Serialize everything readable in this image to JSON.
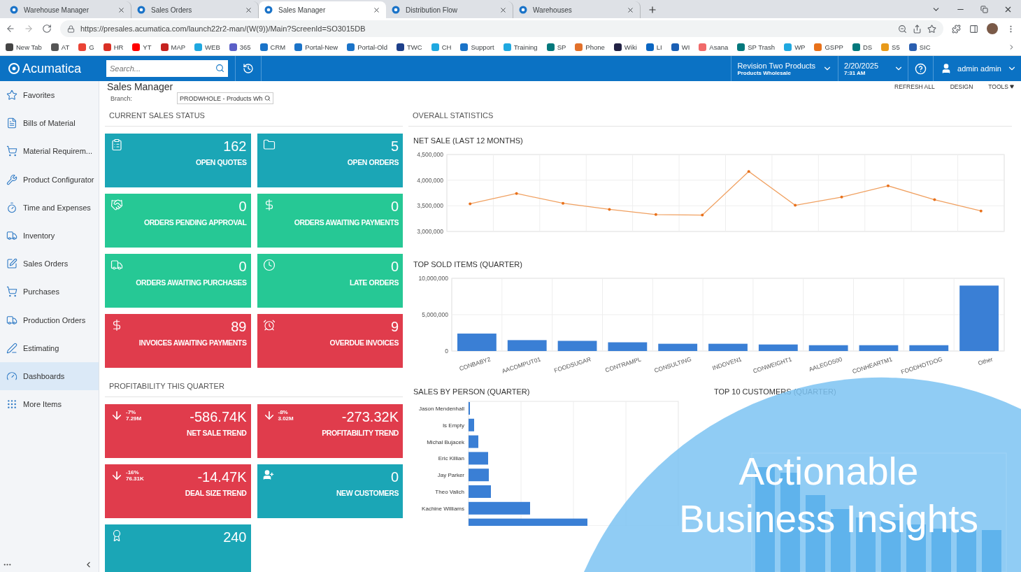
{
  "browser": {
    "tabs": [
      {
        "title": "Warehouse Manager",
        "selected": false
      },
      {
        "title": "Sales Orders",
        "selected": false
      },
      {
        "title": "Sales Manager",
        "selected": true
      },
      {
        "title": "Distribution Flow",
        "selected": false
      },
      {
        "title": "Warehouses",
        "selected": false
      }
    ],
    "url": "https://presales.acumatica.com/launch22r2-man/(W(9))/Main?ScreenId=SO3015DB",
    "bookmarks": [
      {
        "label": "New Tab",
        "color": "#444444"
      },
      {
        "label": "AT",
        "color": "#555555"
      },
      {
        "label": "G",
        "color": "#ea4335"
      },
      {
        "label": "HR",
        "color": "#d93025"
      },
      {
        "label": "YT",
        "color": "#ff0000"
      },
      {
        "label": "MAP",
        "color": "#c5221f"
      },
      {
        "label": "WEB",
        "color": "#1fa8e0"
      },
      {
        "label": "365",
        "color": "#5b5fc7"
      },
      {
        "label": "CRM",
        "color": "#1a73c8"
      },
      {
        "label": "Portal-New",
        "color": "#1a73c8"
      },
      {
        "label": "Portal-Old",
        "color": "#1a73c8"
      },
      {
        "label": "TWC",
        "color": "#1d3f8a"
      },
      {
        "label": "CH",
        "color": "#1fa8e0"
      },
      {
        "label": "Support",
        "color": "#1a73c8"
      },
      {
        "label": "Training",
        "color": "#1fa8e0"
      },
      {
        "label": "SP",
        "color": "#03787c"
      },
      {
        "label": "Phone",
        "color": "#e2712b"
      },
      {
        "label": "Wiki",
        "color": "#222244"
      },
      {
        "label": "LI",
        "color": "#0a66c2"
      },
      {
        "label": "WI",
        "color": "#1a5fb4"
      },
      {
        "label": "Asana",
        "color": "#f06a6a"
      },
      {
        "label": "SP Trash",
        "color": "#03787c"
      },
      {
        "label": "WP",
        "color": "#1fa8e0"
      },
      {
        "label": "GSPP",
        "color": "#e8711a"
      },
      {
        "label": "DS",
        "color": "#03787c"
      },
      {
        "label": "S5",
        "color": "#e89a1a"
      },
      {
        "label": "SIC",
        "color": "#2a5fb0"
      }
    ]
  },
  "app": {
    "logo": "Acumatica",
    "search": {
      "placeholder": "Search..."
    },
    "company": {
      "name": "Revision Two Products",
      "branch": "Products Wholesale"
    },
    "date": "2/20/2025",
    "time": "7:31 AM",
    "user": "admin admin"
  },
  "sidebar": {
    "items": [
      {
        "label": "Favorites",
        "selected": false
      },
      {
        "label": "Bills of Material",
        "selected": false
      },
      {
        "label": "Material Requirem...",
        "selected": false
      },
      {
        "label": "Product Configurator",
        "selected": false
      },
      {
        "label": "Time and Expenses",
        "selected": false
      },
      {
        "label": "Inventory",
        "selected": false
      },
      {
        "label": "Sales Orders",
        "selected": false
      },
      {
        "label": "Purchases",
        "selected": false
      },
      {
        "label": "Production Orders",
        "selected": false
      },
      {
        "label": "Estimating",
        "selected": false
      },
      {
        "label": "Dashboards",
        "selected": true
      },
      {
        "label": "More Items",
        "selected": false
      }
    ]
  },
  "page": {
    "title": "Sales Manager",
    "actions": [
      "REFRESH ALL",
      "DESIGN",
      "TOOLS"
    ],
    "branch": {
      "label": "Branch:",
      "value": "PRODWHOLE - Products Wh"
    }
  },
  "current_sales_status": {
    "title": "CURRENT SALES STATUS",
    "tiles": [
      {
        "value": "162",
        "label": "OPEN QUOTES",
        "color": "#1ba6b6"
      },
      {
        "value": "5",
        "label": "OPEN ORDERS",
        "color": "#1ba6b6"
      },
      {
        "value": "0",
        "label": "ORDERS PENDING APPROVAL",
        "color": "#26c895"
      },
      {
        "value": "0",
        "label": "ORDERS AWAITING PAYMENTS",
        "color": "#26c895"
      },
      {
        "value": "0",
        "label": "ORDERS AWAITING PURCHASES",
        "color": "#26c895"
      },
      {
        "value": "0",
        "label": "LATE ORDERS",
        "color": "#26c895"
      },
      {
        "value": "89",
        "label": "INVOICES AWAITING PAYMENTS",
        "color": "#e03c4c"
      },
      {
        "value": "9",
        "label": "OVERDUE INVOICES",
        "color": "#e03c4c"
      }
    ]
  },
  "profitability": {
    "title": "PROFITABILITY THIS QUARTER",
    "tiles": [
      {
        "kind": "trend",
        "change": "-7%",
        "previous": "7.29M",
        "value": "-586.74K",
        "label": "NET SALE TREND",
        "color": "#e03c4c"
      },
      {
        "kind": "trend",
        "change": "-8%",
        "previous": "3.02M",
        "value": "-273.32K",
        "label": "PROFITABILITY TREND",
        "color": "#e03c4c"
      },
      {
        "kind": "trend",
        "change": "-16%",
        "previous": "76.31K",
        "value": "-14.47K",
        "label": "DEAL SIZE TREND",
        "color": "#e03c4c"
      },
      {
        "kind": "count",
        "value": "0",
        "label": "NEW CUSTOMERS",
        "color": "#1ba6b6"
      },
      {
        "kind": "count",
        "value": "240",
        "color": "#1ba6b6"
      }
    ]
  },
  "overall_statistics": {
    "title": "OVERALL STATISTICS",
    "net_sale": {
      "title": "NET SALE (LAST 12 MONTHS)",
      "chart_data": {
        "type": "line",
        "ylim": [
          3000000,
          4500000
        ],
        "yticks": [
          {
            "value": 3000000,
            "label": "3,000,000"
          },
          {
            "value": 3500000,
            "label": "3,500,000"
          },
          {
            "value": 4000000,
            "label": "4,000,000"
          },
          {
            "value": 4500000,
            "label": "4,500,000"
          }
        ],
        "series": [
          {
            "color": "#f0a060",
            "values": [
              3540000,
              3740000,
              3550000,
              3430000,
              3330000,
              3320000,
              4170000,
              3510000,
              3670000,
              3890000,
              3620000,
              3400000
            ]
          }
        ]
      }
    },
    "top_sold_items": {
      "title": "TOP SOLD ITEMS (QUARTER)",
      "chart_data": {
        "type": "bar",
        "ylim": [
          0,
          10000000
        ],
        "yticks": [
          {
            "value": 0,
            "label": "0"
          },
          {
            "value": 5000000,
            "label": "5,000,000"
          },
          {
            "value": 10000000,
            "label": "10,000,000"
          }
        ],
        "categories": [
          "CONBABY2",
          "AACOMPUT01",
          "FOODSUGAR",
          "CONTRAMPL",
          "CONSULTING",
          "INDOVEN1",
          "CONWEIGHT1",
          "AALEGO500",
          "CONHEARTM1",
          "FOODHOTDOG",
          "Other"
        ],
        "series": [
          {
            "color": "#3a7fd5",
            "values": [
              2400000,
              1500000,
              1400000,
              1200000,
              1000000,
              1000000,
              900000,
              800000,
              800000,
              800000,
              9000000
            ]
          }
        ]
      }
    },
    "sales_by_person": {
      "title": "SALES BY PERSON (QUARTER)",
      "names": [
        "Jason Mendenhall",
        "Is Empty",
        "Michal Bujacek",
        "Eric Killian",
        "Jay Parker",
        "Theo Valich",
        "Kachine Williams"
      ]
    },
    "top_customers": {
      "title": "TOP 10 CUSTOMERS (QUARTER)"
    }
  },
  "overlay_caption": "Actionable Business Insights"
}
